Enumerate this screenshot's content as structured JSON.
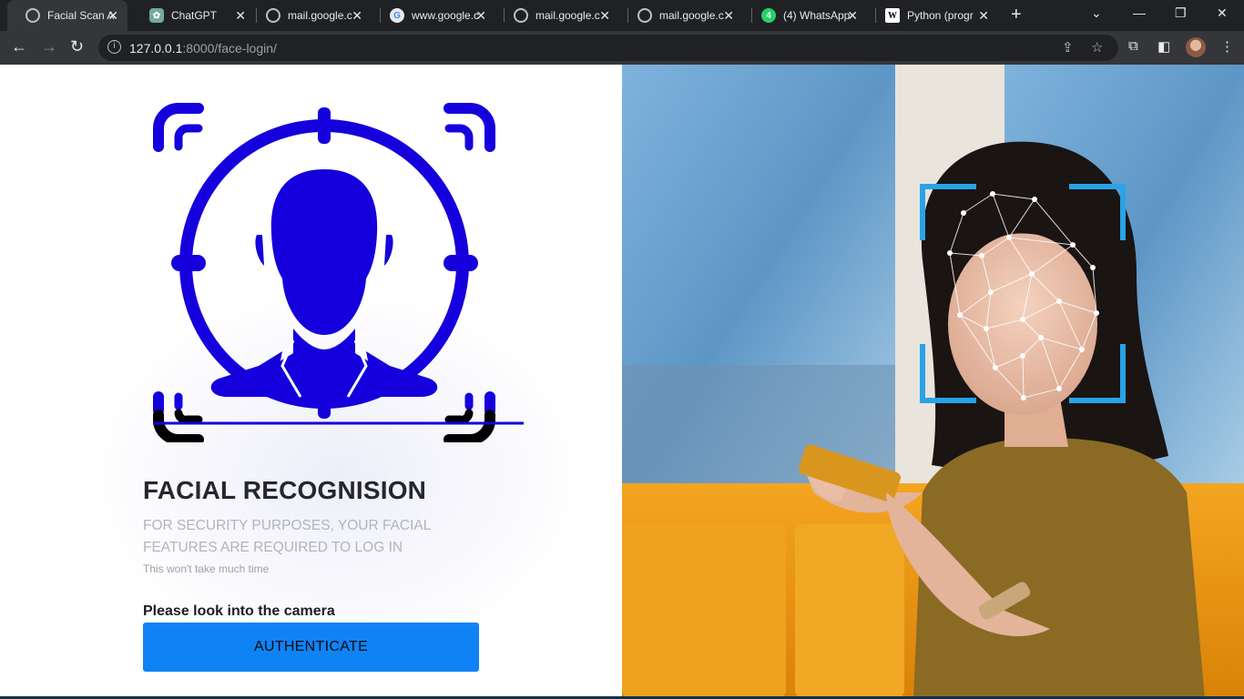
{
  "browser": {
    "tabs": [
      {
        "title": "Facial Scan Au",
        "favicon": "globe-icon",
        "active": true
      },
      {
        "title": "ChatGPT",
        "favicon": "chatgpt-icon",
        "active": false
      },
      {
        "title": "mail.google.c",
        "favicon": "globe-icon",
        "active": false
      },
      {
        "title": "www.google.c",
        "favicon": "google-icon",
        "active": false
      },
      {
        "title": "mail.google.c",
        "favicon": "globe-icon",
        "active": false
      },
      {
        "title": "mail.google.c",
        "favicon": "globe-icon",
        "active": false
      },
      {
        "title": "(4) WhatsApp",
        "favicon": "whatsapp-icon",
        "active": false
      },
      {
        "title": "Python (progr",
        "favicon": "wikipedia-icon",
        "active": false
      }
    ],
    "url_host": "127.0.0.1",
    "url_path": ":8000/face-login/"
  },
  "login": {
    "title": "FACIAL RECOGNISION",
    "subtitle": "FOR SECURITY PURPOSES, YOUR FACIAL FEATURES ARE REQUIRED TO LOG IN",
    "note": "This won't take much time",
    "prompt": "Please look into the camera",
    "button_label": "AUTHENTICATE"
  },
  "colors": {
    "icon_blue": "#1500dd",
    "button_blue": "#0f83f6",
    "scan_frame": "#29a3e6"
  }
}
